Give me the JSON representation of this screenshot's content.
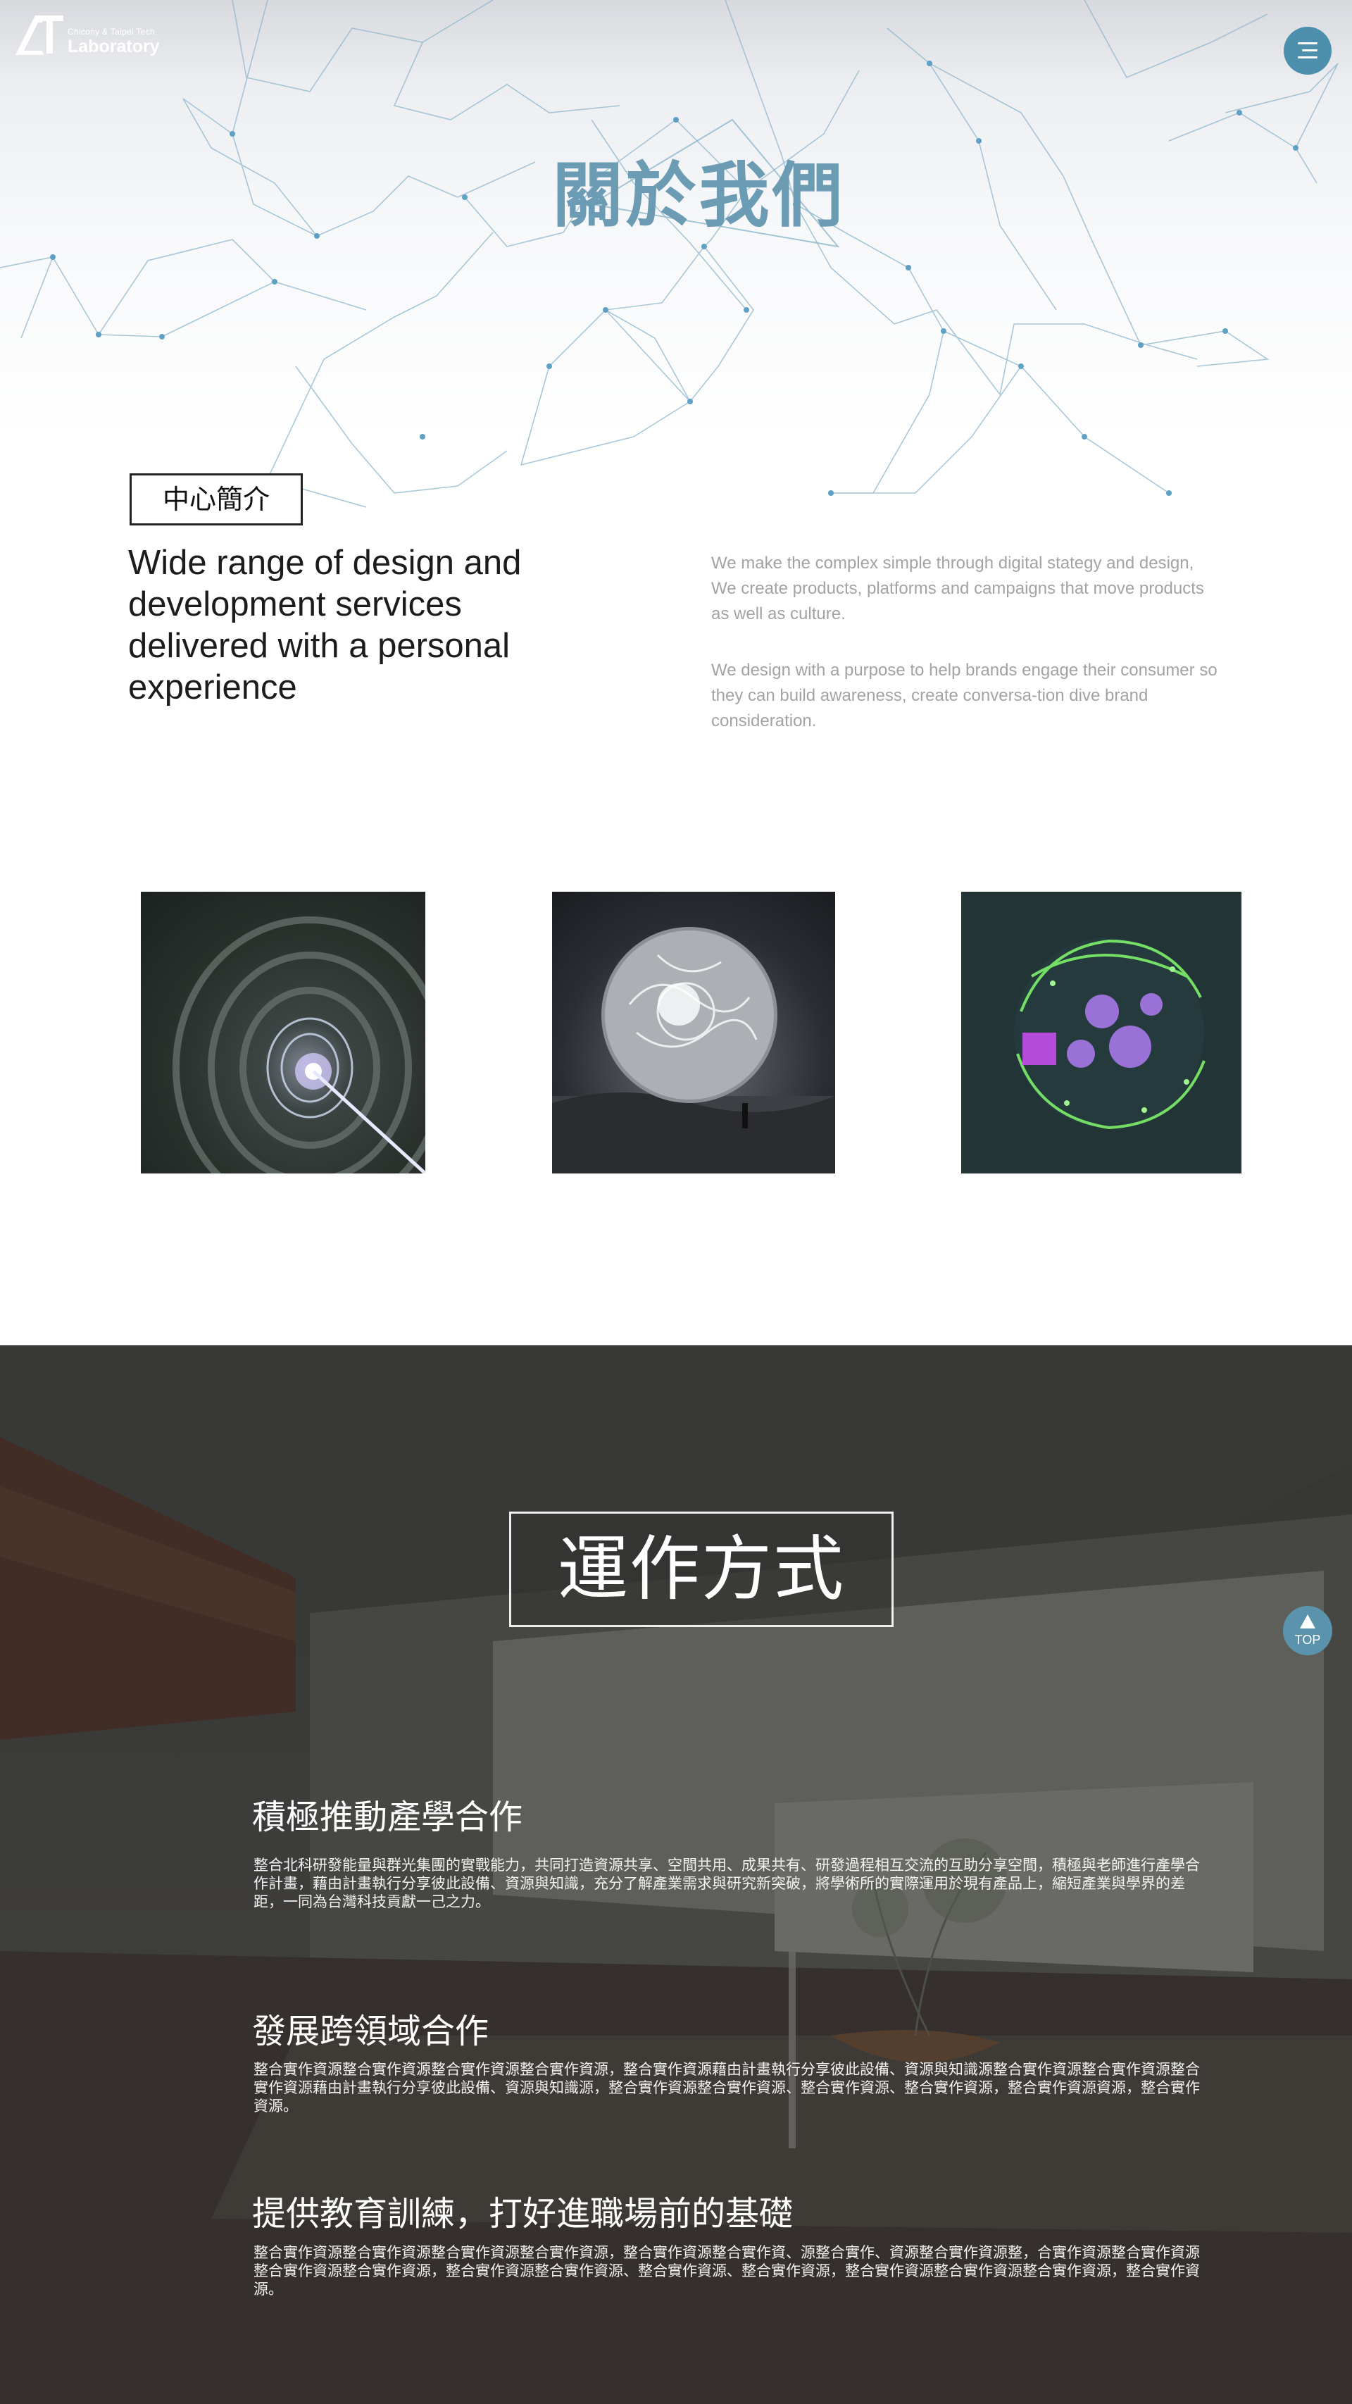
{
  "header": {
    "logo_small": "Chicony & Taipei Tech",
    "logo_main": "Laboratory",
    "menu_icon": "hamburger-icon",
    "accent_color": "#4f8fae"
  },
  "hero": {
    "title": "關於我們",
    "title_color": "#6c9bb4"
  },
  "intro": {
    "label": "中心簡介",
    "heading": "Wide range of design and development services delivered with a personal experience",
    "paragraph_1": "We make the complex simple through digital stategy and design, We create products, platforms and campaigns that move products as well as culture.",
    "paragraph_2": "We design with a purpose to help brands engage their consumer so they can build awareness, create conversa-tion dive brand consideration."
  },
  "gallery": {
    "images": [
      "sci-fi tunnel with light beam",
      "glowing sphere above landscape",
      "green digital globe"
    ]
  },
  "work": {
    "title": "運作方式",
    "sections": [
      {
        "heading": "積極推動產學合作",
        "text": "整合北科研發能量與群光集團的實戰能力，共同打造資源共享、空間共用、成果共有、研發過程相互交流的互助分享空間，積極與老師進行產學合作計畫，藉由計畫執行分享彼此設備、資源與知識，充分了解產業需求與研究新突破，將學術所的實際運用於現有產品上，縮短產業與學界的差距，一同為台灣科技貢獻一己之力。"
      },
      {
        "heading": "發展跨領域合作",
        "text": "整合實作資源整合實作資源整合實作資源整合實作資源，整合實作資源藉由計畫執行分享彼此設備、資源與知識源整合實作資源整合實作資源整合實作資源藉由計畫執行分享彼此設備、資源與知識源，整合實作資源整合實作資源、整合實作資源、整合實作資源，整合實作資源資源，整合實作資源。"
      },
      {
        "heading": "提供教育訓練，打好進職場前的基礎",
        "text": "整合實作資源整合實作資源整合實作資源整合實作資源，整合實作資源整合實作資、源整合實作、資源整合實作資源整，合實作資源整合實作資源整合實作資源整合實作資源，整合實作資源整合實作資源、整合實作資源、整合實作資源，整合實作資源整合實作資源整合實作資源，整合實作資源。"
      }
    ]
  },
  "top_button": {
    "label": "TOP",
    "icon": "arrow-up-icon",
    "color": "#5b93ad"
  }
}
